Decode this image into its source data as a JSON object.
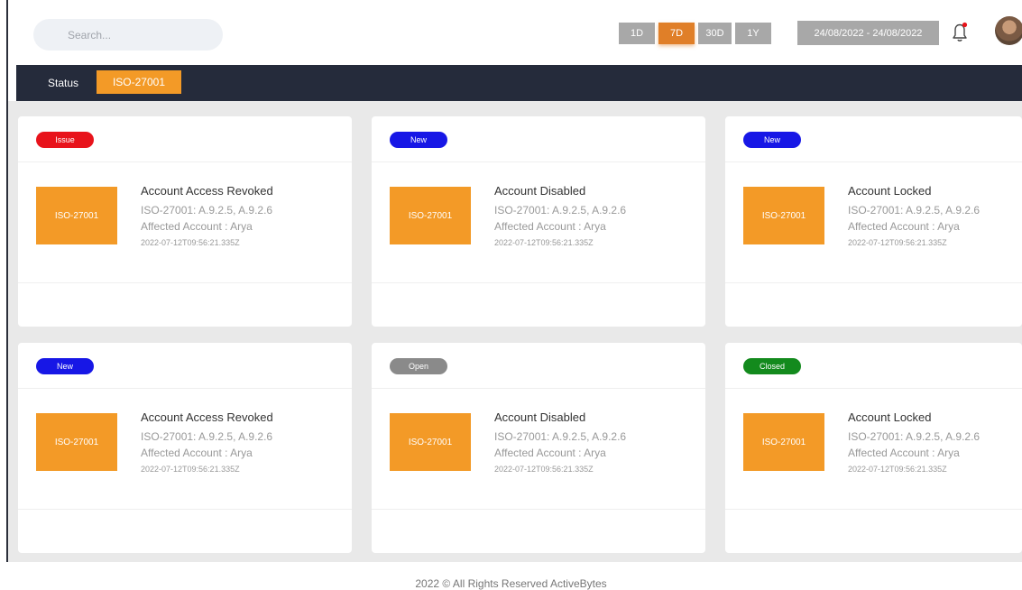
{
  "search": {
    "placeholder": "Search..."
  },
  "ranges": [
    {
      "label": "1D",
      "active": false
    },
    {
      "label": "7D",
      "active": true
    },
    {
      "label": "30D",
      "active": false
    },
    {
      "label": "1Y",
      "active": false
    }
  ],
  "date_range": "24/08/2022 - 24/08/2022",
  "statusbar": {
    "label": "Status",
    "chip": "ISO-27001"
  },
  "colors": {
    "accent": "#f39a27",
    "issue": "#e8131b",
    "new": "#1717e6",
    "open": "#8a8a8a",
    "closed": "#138a1d",
    "dark": "#252b3b"
  },
  "cards": [
    {
      "badge": "Issue",
      "badge_color": "#e8131b",
      "tile": "ISO-27001",
      "title": "Account Access Revoked",
      "controls": "ISO-27001: A.9.2.5, A.9.2.6",
      "account": "Affected Account : Arya",
      "timestamp": "2022-07-12T09:56:21.335Z"
    },
    {
      "badge": "New",
      "badge_color": "#1717e6",
      "tile": "ISO-27001",
      "title": "Account Disabled",
      "controls": "ISO-27001: A.9.2.5, A.9.2.6",
      "account": "Affected Account : Arya",
      "timestamp": "2022-07-12T09:56:21.335Z"
    },
    {
      "badge": "New",
      "badge_color": "#1717e6",
      "tile": "ISO-27001",
      "title": "Account Locked",
      "controls": "ISO-27001: A.9.2.5, A.9.2.6",
      "account": "Affected Account : Arya",
      "timestamp": "2022-07-12T09:56:21.335Z"
    },
    {
      "badge": "New",
      "badge_color": "#1717e6",
      "tile": "ISO-27001",
      "title": "Account Access Revoked",
      "controls": "ISO-27001: A.9.2.5, A.9.2.6",
      "account": "Affected Account : Arya",
      "timestamp": "2022-07-12T09:56:21.335Z"
    },
    {
      "badge": "Open",
      "badge_color": "#8a8a8a",
      "tile": "ISO-27001",
      "title": "Account Disabled",
      "controls": "ISO-27001: A.9.2.5, A.9.2.6",
      "account": "Affected Account : Arya",
      "timestamp": "2022-07-12T09:56:21.335Z"
    },
    {
      "badge": "Closed",
      "badge_color": "#138a1d",
      "tile": "ISO-27001",
      "title": "Account Locked",
      "controls": "ISO-27001: A.9.2.5, A.9.2.6",
      "account": "Affected Account : Arya",
      "timestamp": "2022-07-12T09:56:21.335Z"
    }
  ],
  "footer": {
    "text": "2022 © All Rights Reserved ActiveBytes"
  },
  "icons": {
    "bell": "bell-icon",
    "avatar": "avatar"
  }
}
